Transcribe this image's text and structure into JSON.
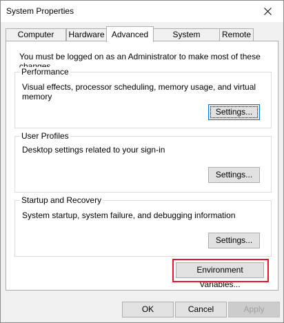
{
  "window": {
    "title": "System Properties"
  },
  "tabs": [
    {
      "label": "Computer Name"
    },
    {
      "label": "Hardware"
    },
    {
      "label": "Advanced"
    },
    {
      "label": "System Protection"
    },
    {
      "label": "Remote"
    }
  ],
  "active_tab": "Advanced",
  "advanced": {
    "admin_note": "You must be logged on as an Administrator to make most of these changes.",
    "performance": {
      "label": "Performance",
      "description": "Visual effects, processor scheduling, memory usage, and virtual memory",
      "settings_label": "Settings..."
    },
    "user_profiles": {
      "label": "User Profiles",
      "description": "Desktop settings related to your sign-in",
      "settings_label": "Settings..."
    },
    "startup_recovery": {
      "label": "Startup and Recovery",
      "description": "System startup, system failure, and debugging information",
      "settings_label": "Settings..."
    },
    "env_vars_label": "Environment Variables..."
  },
  "footer": {
    "ok_label": "OK",
    "cancel_label": "Cancel",
    "apply_label": "Apply"
  },
  "icons": {
    "close": "close-icon"
  },
  "colors": {
    "highlight": "#e8162b",
    "focus": "#0078d7"
  }
}
